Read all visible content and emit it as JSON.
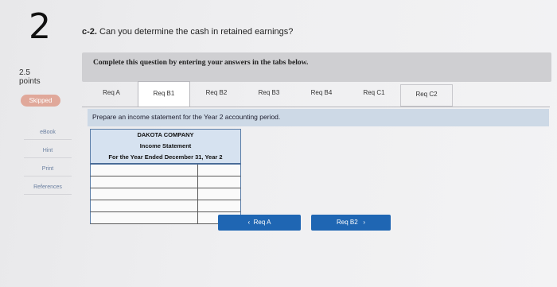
{
  "question_number": "2",
  "points": {
    "value": "2.5",
    "label": "points"
  },
  "status_badge": "Skipped",
  "side_links": [
    "eBook",
    "Hint",
    "Print",
    "References"
  ],
  "question": {
    "prefix": "c-2.",
    "text": "Can you determine the cash in retained earnings?"
  },
  "instruction": "Complete this question by entering your answers in the tabs below.",
  "tabs": [
    "Req A",
    "Req B1",
    "Req B2",
    "Req B3",
    "Req B4",
    "Req C1",
    "Req C2"
  ],
  "active_tab": "Req B1",
  "prompt": "Prepare an income statement for the Year 2 accounting period.",
  "statement": {
    "company": "DAKOTA COMPANY",
    "title": "Income Statement",
    "period": "For the Year Ended December 31, Year 2"
  },
  "nav": {
    "prev": "Req A",
    "next": "Req B2",
    "prev_arrow": "‹",
    "next_arrow": "›"
  },
  "colors": {
    "nav_button": "#1f66b3",
    "badge": "#e0a89a",
    "link": "#6a7fa0"
  }
}
